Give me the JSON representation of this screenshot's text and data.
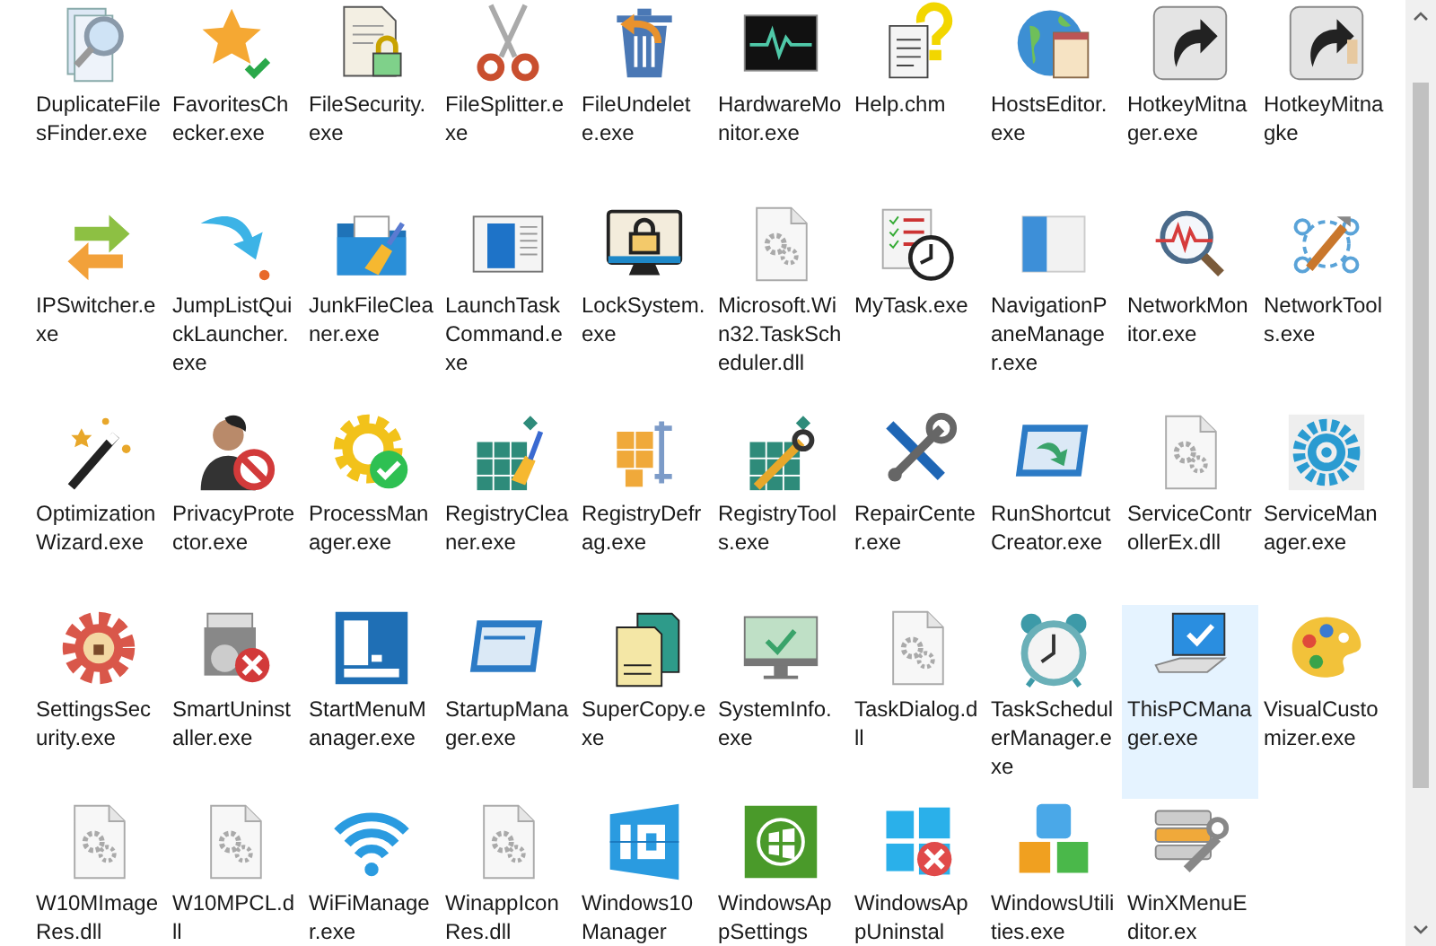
{
  "items": [
    {
      "label": "DuplicateFilesFinder.exe",
      "kind": "application",
      "selected": false
    },
    {
      "label": "FavoritesChecker.exe",
      "kind": "application",
      "selected": false
    },
    {
      "label": "FileSecurity.exe",
      "kind": "application",
      "selected": false
    },
    {
      "label": "FileSplitter.exe",
      "kind": "application",
      "selected": false
    },
    {
      "label": "FileUndelete.exe",
      "kind": "application",
      "selected": false
    },
    {
      "label": "HardwareMonitor.exe",
      "kind": "application",
      "selected": false
    },
    {
      "label": "Help.chm",
      "kind": "application",
      "selected": false
    },
    {
      "label": "HostsEditor.exe",
      "kind": "application",
      "selected": false
    },
    {
      "label": "HotkeyMitnager.exe",
      "kind": "application",
      "selected": false
    },
    {
      "label": "HotkeyMitnagke",
      "kind": "application",
      "selected": false
    },
    {
      "label": "IPSwitcher.exe",
      "kind": "application",
      "selected": false
    },
    {
      "label": "JumpListQuickLauncher.exe",
      "kind": "application",
      "selected": false
    },
    {
      "label": "JunkFileCleaner.exe",
      "kind": "application",
      "selected": false
    },
    {
      "label": "LaunchTaskCommand.exe",
      "kind": "application",
      "selected": false
    },
    {
      "label": "LockSystem.exe",
      "kind": "application",
      "selected": false
    },
    {
      "label": "Microsoft.Win32.TaskScheduler.dll",
      "kind": "library",
      "selected": false
    },
    {
      "label": "MyTask.exe",
      "kind": "application",
      "selected": false
    },
    {
      "label": "NavigationPaneManager.exe",
      "kind": "application",
      "selected": false
    },
    {
      "label": "NetworkMonitor.exe",
      "kind": "application",
      "selected": false
    },
    {
      "label": "NetworkTools.exe",
      "kind": "application",
      "selected": false
    },
    {
      "label": "OptimizationWizard.exe",
      "kind": "application",
      "selected": false
    },
    {
      "label": "PrivacyProtector.exe",
      "kind": "application",
      "selected": false
    },
    {
      "label": "ProcessManager.exe",
      "kind": "application",
      "selected": false
    },
    {
      "label": "RegistryCleaner.exe",
      "kind": "application",
      "selected": false
    },
    {
      "label": "RegistryDefrag.exe",
      "kind": "application",
      "selected": false
    },
    {
      "label": "RegistryTools.exe",
      "kind": "application",
      "selected": false
    },
    {
      "label": "RepairCenter.exe",
      "kind": "application",
      "selected": false
    },
    {
      "label": "RunShortcutCreator.exe",
      "kind": "application",
      "selected": false
    },
    {
      "label": "ServiceControllerEx.dll",
      "kind": "library",
      "selected": false
    },
    {
      "label": "ServiceManager.exe",
      "kind": "application",
      "selected": false
    },
    {
      "label": "SettingsSecurity.exe",
      "kind": "application",
      "selected": false
    },
    {
      "label": "SmartUninstaller.exe",
      "kind": "application",
      "selected": false
    },
    {
      "label": "StartMenuManager.exe",
      "kind": "application",
      "selected": false
    },
    {
      "label": "StartupManager.exe",
      "kind": "application",
      "selected": false
    },
    {
      "label": "SuperCopy.exe",
      "kind": "application",
      "selected": false
    },
    {
      "label": "SystemInfo.exe",
      "kind": "application",
      "selected": false
    },
    {
      "label": "TaskDialog.dll",
      "kind": "library",
      "selected": false
    },
    {
      "label": "TaskSchedulerManager.exe",
      "kind": "application",
      "selected": false
    },
    {
      "label": "ThisPCManager.exe",
      "kind": "application",
      "selected": true
    },
    {
      "label": "VisualCustomizer.exe",
      "kind": "application",
      "selected": false
    },
    {
      "label": "W10MImageRes.dll",
      "kind": "library",
      "selected": false
    },
    {
      "label": "W10MPCL.dll",
      "kind": "library",
      "selected": false
    },
    {
      "label": "WiFiManager.exe",
      "kind": "application",
      "selected": false
    },
    {
      "label": "WinappIconRes.dll",
      "kind": "library",
      "selected": false
    },
    {
      "label": "Windows10Manager",
      "kind": "application",
      "selected": false
    },
    {
      "label": "WindowsAppSettings",
      "kind": "application",
      "selected": false
    },
    {
      "label": "WindowsAppUninstal",
      "kind": "application",
      "selected": false
    },
    {
      "label": "WindowsUtilities.exe",
      "kind": "application",
      "selected": false
    },
    {
      "label": "WinXMenuEditor.ex",
      "kind": "application",
      "selected": false
    }
  ]
}
